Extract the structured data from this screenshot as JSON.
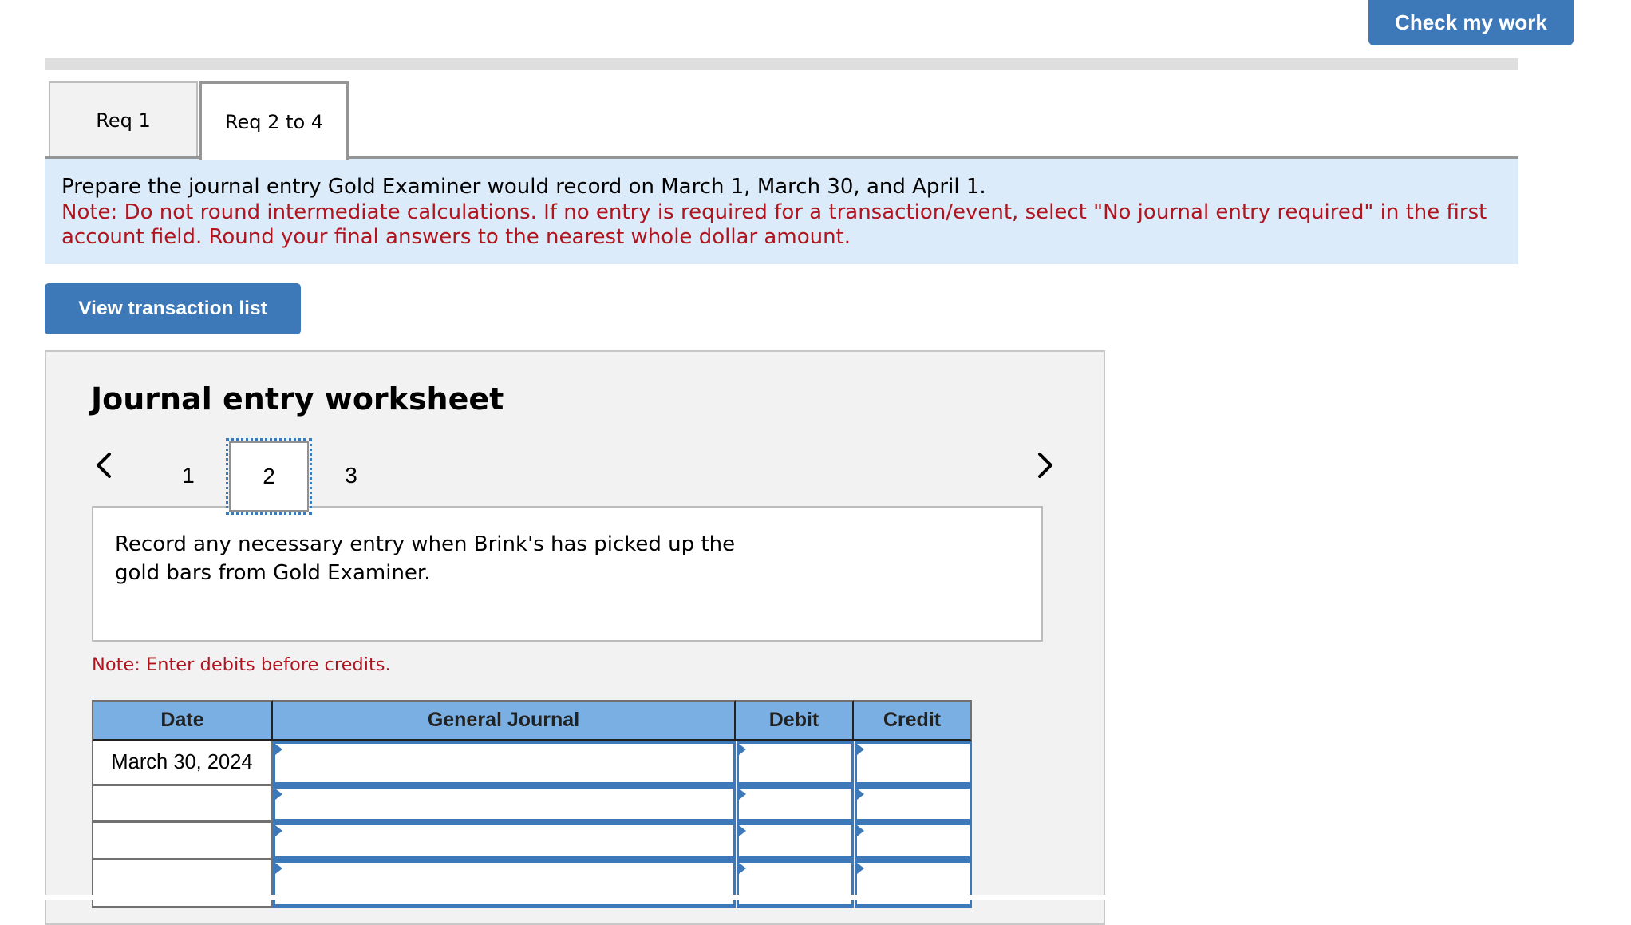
{
  "header": {
    "check_my_work_label": "Check my work"
  },
  "tabs": [
    {
      "label": "Req 1",
      "active": false
    },
    {
      "label": "Req 2 to 4",
      "active": true
    }
  ],
  "instructions": {
    "prompt": "Prepare the journal entry Gold Examiner would record on March 1, March 30, and April 1.",
    "note": "Note: Do not round intermediate calculations. If no entry is required for a transaction/event, select \"No journal entry required\" in the first account field. Round your final answers to the nearest whole dollar amount."
  },
  "view_transaction_list_label": "View transaction list",
  "worksheet": {
    "title": "Journal entry worksheet",
    "pager": {
      "pages": [
        "1",
        "2",
        "3"
      ],
      "current": "2",
      "prev_icon": "chevron-left-icon",
      "next_icon": "chevron-right-icon"
    },
    "description": "Record any necessary entry when Brink's has picked up the gold bars from Gold Examiner.",
    "note": "Note: Enter debits before credits.",
    "table": {
      "headers": {
        "date": "Date",
        "general_journal": "General Journal",
        "debit": "Debit",
        "credit": "Credit"
      },
      "rows": [
        {
          "date": "March 30, 2024",
          "account": "",
          "debit": "",
          "credit": ""
        },
        {
          "date": "",
          "account": "",
          "debit": "",
          "credit": ""
        },
        {
          "date": "",
          "account": "",
          "debit": "",
          "credit": ""
        },
        {
          "date": "",
          "account": "",
          "debit": "",
          "credit": ""
        }
      ]
    }
  },
  "colors": {
    "accent_blue": "#3d78b8",
    "note_red": "#b0151f",
    "table_header": "#7aafe3",
    "instruction_bg": "#dbebf9"
  }
}
